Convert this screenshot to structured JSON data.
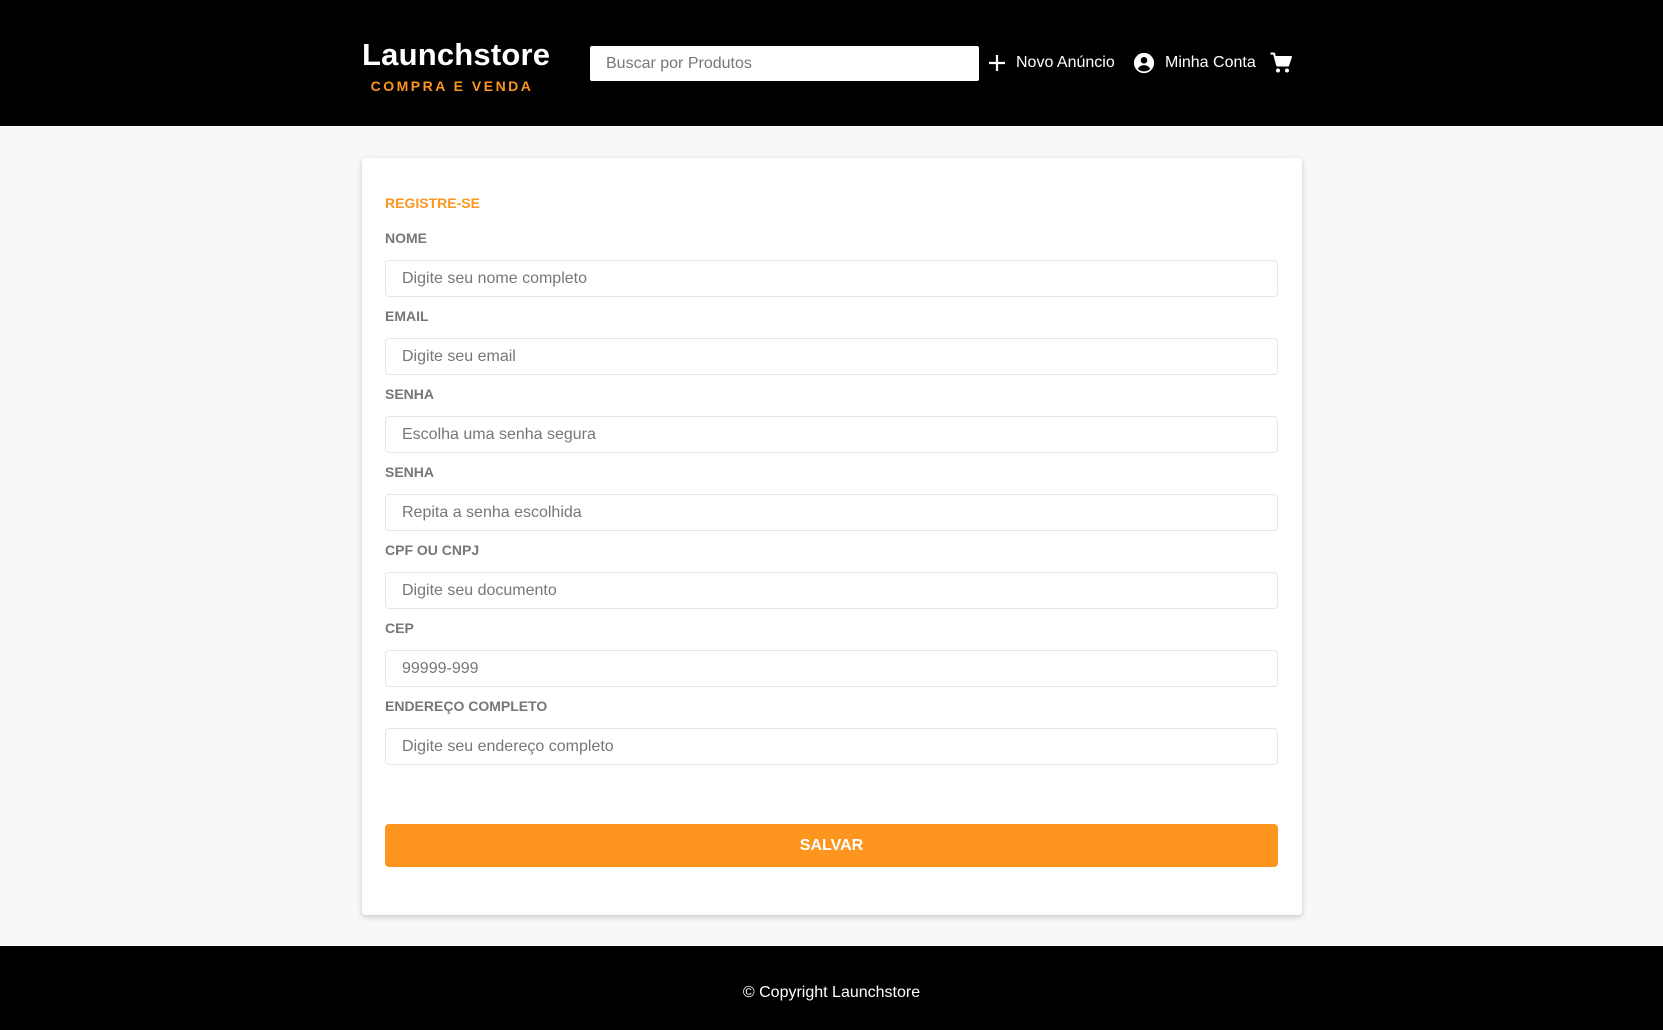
{
  "header": {
    "logo_title": "Launchstore",
    "logo_subtitle": "COMPRA E VENDA",
    "search_placeholder": "Buscar por Produtos",
    "new_listing_label": "Novo Anúncio",
    "account_label": "Minha Conta",
    "icons": [
      "plus-icon",
      "account-circle-icon",
      "shopping-cart-icon"
    ]
  },
  "form": {
    "title": "REGISTRE-SE",
    "fields": [
      {
        "label": "NOME",
        "value": "",
        "placeholder": "Digite seu nome completo"
      },
      {
        "label": "EMAIL",
        "value": "",
        "placeholder": "Digite seu email"
      },
      {
        "label": "SENHA",
        "value": "",
        "placeholder": "Escolha uma senha segura"
      },
      {
        "label": "SENHA",
        "value": "",
        "placeholder": "Repita a senha escolhida"
      },
      {
        "label": "CPF OU CNPJ",
        "value": "",
        "placeholder": "Digite seu documento"
      },
      {
        "label": "CEP",
        "value": "",
        "placeholder": "99999-999"
      },
      {
        "label": "ENDEREÇO COMPLETO",
        "value": "",
        "placeholder": "Digite seu endereço completo"
      }
    ],
    "submit_label": "SALVAR"
  },
  "footer": {
    "copyright": "© Copyright Launchstore"
  },
  "colors": {
    "accent": "#fd951f",
    "header_bg": "#000000",
    "page_bg": "#f8f8f8",
    "label_gray": "#777777"
  }
}
